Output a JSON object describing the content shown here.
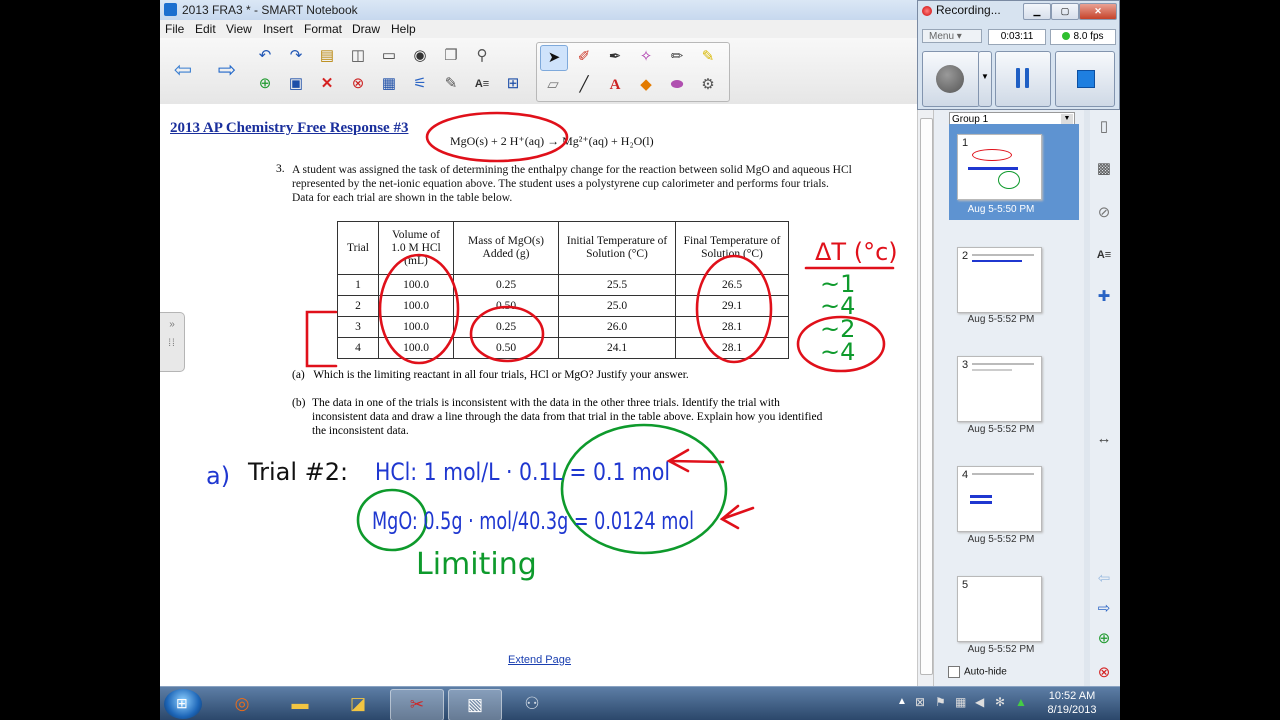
{
  "window": {
    "title": "2013 FRA3 * - SMART Notebook"
  },
  "menu": {
    "items": [
      "File",
      "Edit",
      "View",
      "Insert",
      "Format",
      "Draw",
      "Help"
    ]
  },
  "toolbar": {
    "row1": [
      "back-arrow-icon",
      "forward-arrow-icon",
      "undo-icon",
      "redo-icon",
      "paste-icon",
      "screen-shade-icon",
      "show-hide-icon",
      "camera-icon",
      "copy-icon",
      "magic-pen-icon",
      "select-icon",
      "pens-icon",
      "creative-pen-icon",
      "magic-pen2-icon",
      "highlighter-icon"
    ],
    "row2": [
      "add-page-icon",
      "save-icon",
      "delete-icon",
      "reject-icon",
      "screen-capture-icon",
      "tools-icon",
      "table-icon",
      "eraser-icon",
      "line-icon",
      "text-icon",
      "fill-icon",
      "properties-icon",
      "pointer-icon"
    ]
  },
  "document": {
    "title": "2013 AP Chemistry Free Response #3",
    "equation": "MgO(s) + 2 H⁺(aq) → Mg²⁺(aq) + H₂O(l)",
    "question_number": "3.",
    "question_text": "A student was assigned the task of determining the enthalpy change for the reaction between solid MgO and aqueous HCl represented by the net-ionic equation above. The student uses a polystyrene cup calorimeter and performs four trials. Data for each trial are shown in the table below.",
    "table": {
      "headers": [
        "Trial",
        "Volume of 1.0 M HCl (mL)",
        "Mass of MgO(s) Added (g)",
        "Initial Temperature of Solution (°C)",
        "Final Temperature of Solution (°C)"
      ],
      "rows": [
        [
          "1",
          "100.0",
          "0.25",
          "25.5",
          "26.5"
        ],
        [
          "2",
          "100.0",
          "0.50",
          "25.0",
          "29.1"
        ],
        [
          "3",
          "100.0",
          "0.25",
          "26.0",
          "28.1"
        ],
        [
          "4",
          "100.0",
          "0.50",
          "24.1",
          "28.1"
        ]
      ]
    },
    "part_a_label": "(a)",
    "part_a_text": "Which is the limiting reactant in all four trials, HCl or MgO? Justify your answer.",
    "part_b_label": "(b)",
    "part_b_text": "The data in one of the trials is inconsistent with the data in the other three trials. Identify the trial with inconsistent data and draw a line through the data from that trial in the table above. Explain how you identified the inconsistent data.",
    "extend_link": "Extend Page"
  },
  "ink": {
    "delta_t": "ΔT (°c)",
    "approx": [
      "~1",
      "~4",
      "~2",
      "~4"
    ],
    "answer_a": "a)",
    "trial_label": "Trial #2:",
    "hcl_line": "HCl: 1 mol/L · 0.1L = 0.1 mol",
    "mgo_line": "MgO: 0.5g · mol/40.3g = 0.0124 mol",
    "limiting": "Limiting",
    "colors": {
      "red": "#e0101a",
      "blue": "#1f37d0",
      "green": "#0e9a2c"
    }
  },
  "sidebar": {
    "group": "Group 1",
    "pages": [
      {
        "num": "1",
        "time": "Aug 5-5:50 PM",
        "selected": true
      },
      {
        "num": "2",
        "time": "Aug 5-5:52 PM",
        "selected": false
      },
      {
        "num": "3",
        "time": "Aug 5-5:52 PM",
        "selected": false
      },
      {
        "num": "4",
        "time": "Aug 5-5:52 PM",
        "selected": false
      },
      {
        "num": "5",
        "time": "Aug 5-5:52 PM",
        "selected": false
      }
    ],
    "autohide": "Auto-hide"
  },
  "recorder": {
    "title": "Recording...",
    "menu": "Menu",
    "time": "0:03:11",
    "fps": "8.0 fps"
  },
  "taskbar": {
    "time": "10:52 AM",
    "date": "8/19/2013"
  }
}
